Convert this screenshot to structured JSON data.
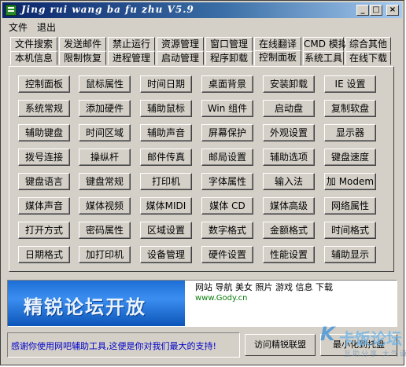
{
  "window": {
    "title": "Jing rui wang ba fu zhu V5.9",
    "controls": {
      "minimize": "_",
      "maximize": "□",
      "close": "×"
    }
  },
  "menu": [
    "文件",
    "退出"
  ],
  "tabs": {
    "row1": [
      "文件搜索",
      "发送邮件",
      "禁止运行",
      "资源管理",
      "窗口管理",
      "在线翻译",
      "CMD 模拟",
      "综合其他"
    ],
    "row2": [
      "本机信息",
      "限制恢复",
      "进程管理",
      "启动管理",
      "程序卸载",
      "控制面板",
      "系统工具",
      "在线下载"
    ],
    "active": "控制面板"
  },
  "grid": [
    [
      "控制面板",
      "鼠标属性",
      "时间日期",
      "桌面背景",
      "安装卸载",
      "IE 设置"
    ],
    [
      "系统常规",
      "添加硬件",
      "辅助鼠标",
      "Win 组件",
      "启动盘",
      "复制软盘"
    ],
    [
      "辅助键盘",
      "时间区域",
      "辅助声音",
      "屏幕保护",
      "外观设置",
      "显示器"
    ],
    [
      "拨号连接",
      "操纵杆",
      "邮件传真",
      "邮局设置",
      "辅助选项",
      "键盘速度"
    ],
    [
      "键盘语言",
      "键盘常规",
      "打印机",
      "字体属性",
      "输入法",
      "加 Modem"
    ],
    [
      "媒体声音",
      "媒体视频",
      "媒体MIDI",
      "媒体 CD",
      "媒体高级",
      "网络属性"
    ],
    [
      "打开方式",
      "密码属性",
      "区域设置",
      "数字格式",
      "金额格式",
      "时间格式"
    ],
    [
      "日期格式",
      "加打印机",
      "设备管理",
      "硬件设置",
      "性能设置",
      "辅助显示"
    ]
  ],
  "banner": {
    "left_text": "精锐论坛开放",
    "nav": "网站 导航 美女 照片 游戏 信息 下载",
    "url": "www.Gody.cn"
  },
  "status": {
    "text": "感谢你使用网吧辅助工具,这便是你对我们最大的支持!"
  },
  "buttons": {
    "visit": "访问精锐联盟",
    "tray": "最小化到托盘"
  },
  "watermark": {
    "main": "卡饭论坛",
    "sub": "互助分享 大气谦和"
  }
}
